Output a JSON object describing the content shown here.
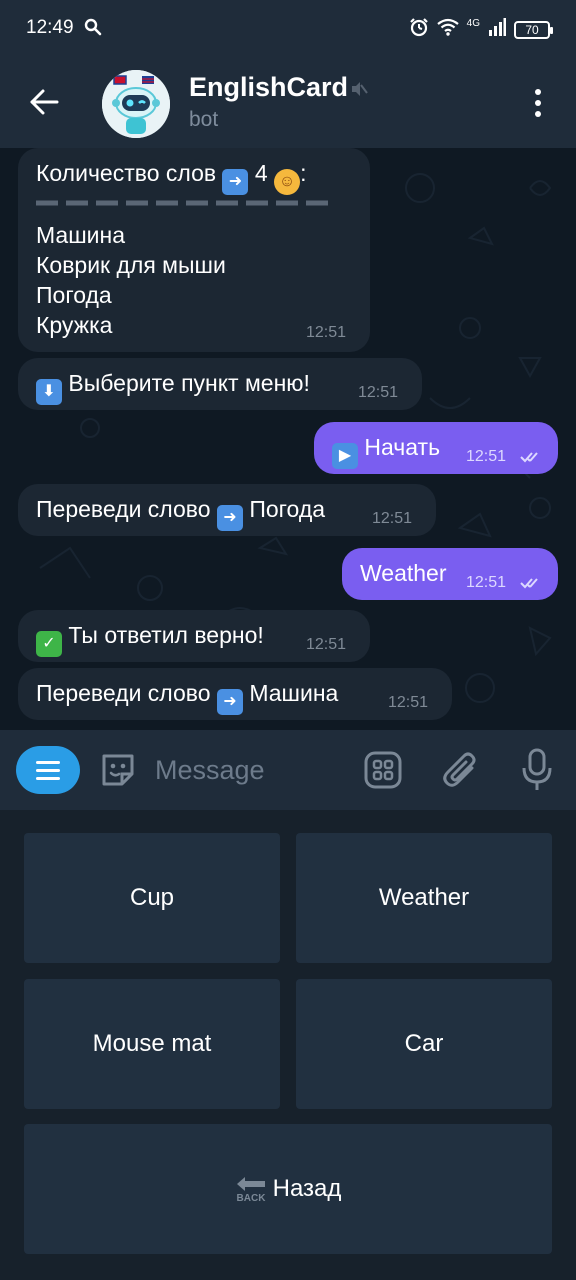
{
  "status_bar": {
    "time": "12:49",
    "network": "4G",
    "battery": "70"
  },
  "header": {
    "title": "EnglishCard",
    "subtitle": "bot"
  },
  "messages": [
    {
      "direction": "in",
      "lines": [
        "Количество слов",
        "4",
        ":"
      ],
      "list": [
        "Машина",
        "Коврик для мыши",
        "Погода",
        "Кружка"
      ],
      "time": "12:51"
    },
    {
      "direction": "in",
      "text": "Выберите пункт меню!",
      "time": "12:51"
    },
    {
      "direction": "out",
      "text": "Начать",
      "time": "12:51"
    },
    {
      "direction": "in",
      "text": "Переведи слово",
      "word": "Погода",
      "time": "12:51"
    },
    {
      "direction": "out",
      "text": "Weather",
      "time": "12:51"
    },
    {
      "direction": "in",
      "text": "Ты ответил верно!",
      "time": "12:51"
    },
    {
      "direction": "in",
      "text": "Переведи слово",
      "word": "Машина",
      "time": "12:51"
    }
  ],
  "input": {
    "placeholder": "Message"
  },
  "keyboard": {
    "buttons": [
      {
        "label": "Cup"
      },
      {
        "label": "Weather"
      },
      {
        "label": "Mouse mat"
      },
      {
        "label": "Car"
      },
      {
        "label": "Назад",
        "icon_text": "BACK"
      }
    ]
  },
  "colors": {
    "accent": "#2a9de6",
    "outgoing_bubble": "#7a5ef0",
    "incoming_bubble": "#1c2733",
    "chat_background": "#0f1923",
    "header": "#1f2c3a",
    "keyboard_button": "#213040"
  },
  "icons": {
    "back": "arrow-left-icon",
    "mute": "muted-speaker-icon",
    "menu": "three-dots-vertical-icon",
    "bot_menu": "hamburger-icon",
    "sticker": "sticker-smile-icon",
    "commands": "grid-icon",
    "attach": "paperclip-icon",
    "mic": "microphone-icon",
    "read": "double-check-icon"
  }
}
